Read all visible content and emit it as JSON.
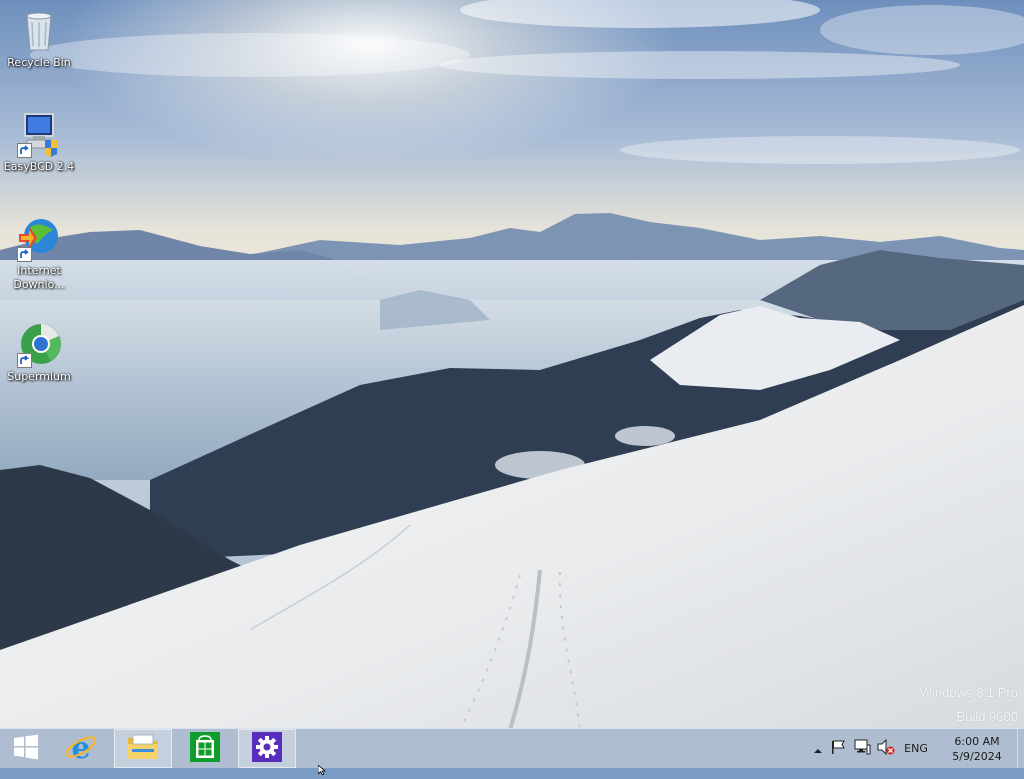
{
  "desktop": {
    "icons": [
      {
        "label": "Recycle Bin",
        "icon": "recycle-bin-icon"
      },
      {
        "label": "EasyBCD 2.4",
        "icon": "easybcd-icon"
      },
      {
        "label": "Internet\nDownlo...",
        "icon": "internet-download-manager-icon"
      },
      {
        "label": "Supermium",
        "icon": "supermium-browser-icon"
      }
    ]
  },
  "watermark": {
    "line1": "Windows 8.1 Pro",
    "line2": "Build 9600"
  },
  "taskbar": {
    "items": [
      {
        "icon": "windows-start-icon"
      },
      {
        "icon": "internet-explorer-icon"
      },
      {
        "icon": "file-explorer-icon"
      },
      {
        "icon": "store-icon"
      },
      {
        "icon": "settings-gear-icon"
      }
    ],
    "tray": {
      "language": "ENG",
      "time": "6:00 AM",
      "date": "5/9/2024"
    }
  },
  "colors": {
    "taskbar": "#b0bed0",
    "store_green": "#0f9d2c",
    "settings_purple": "#5b2dbd",
    "start_blue": "#ffffff"
  }
}
